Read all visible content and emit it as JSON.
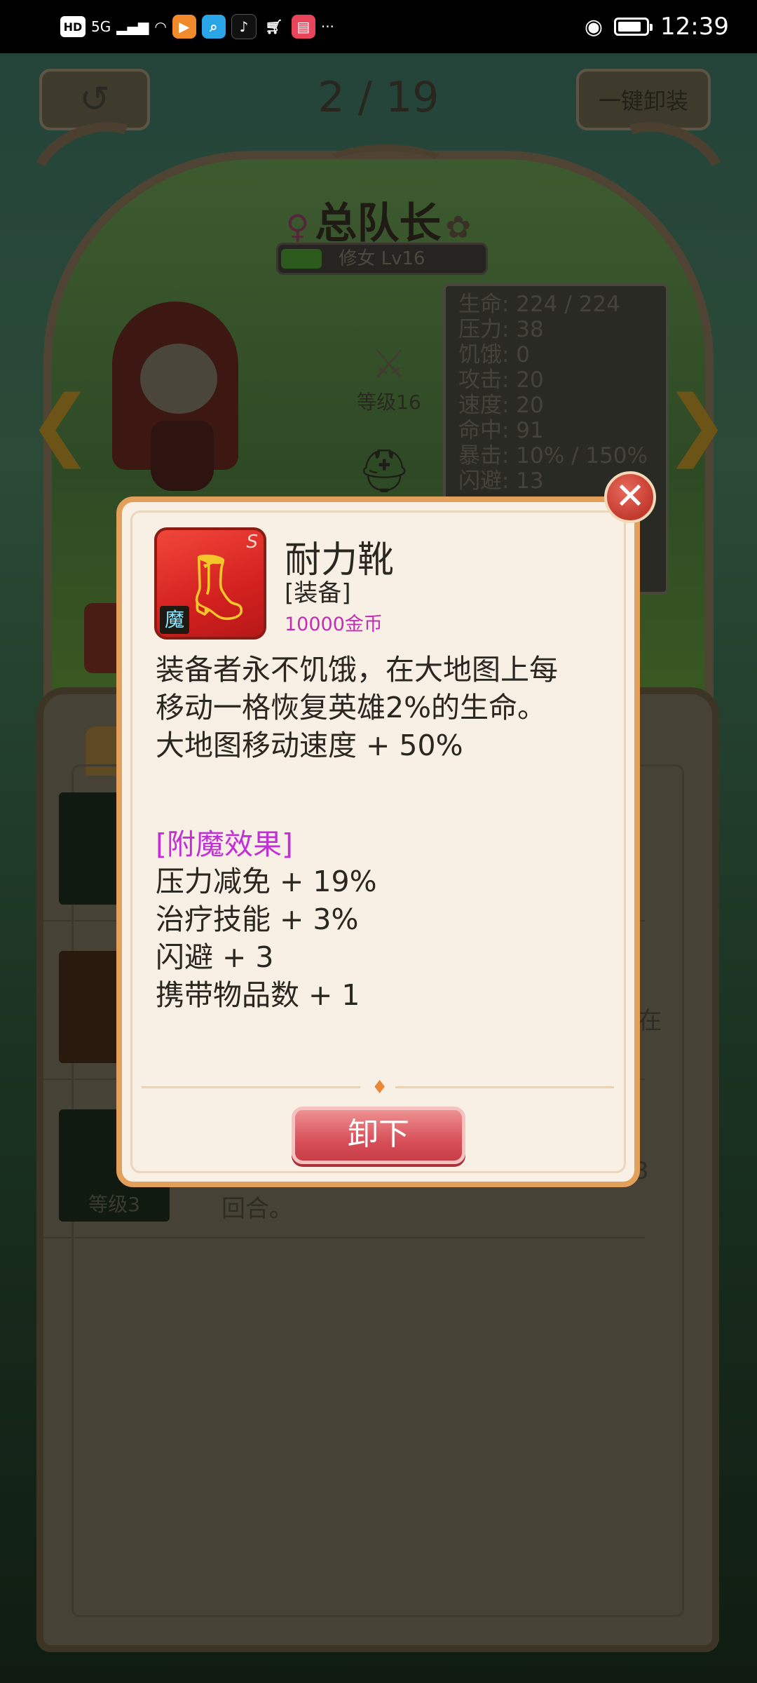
{
  "status_bar": {
    "hd": "HD",
    "network": "5G",
    "more": "···",
    "time": "12:39",
    "battery_level": 0.85,
    "app_icons": [
      "video-app",
      "search-app",
      "tiktok-app",
      "shopping-app",
      "reader-app"
    ]
  },
  "header": {
    "page_counter": "2 / 19",
    "unequip_all": "一键卸装"
  },
  "hero": {
    "name": "总队长",
    "class_level": "修女 Lv16",
    "xp_fraction": 0.2,
    "weapon_level": "等级16",
    "stats": [
      "生命: 224 / 224",
      "压力: 38",
      "饥饿: 0",
      "攻击: 20",
      "速度: 20",
      "命中: 91",
      "暴击: 10% / 150%",
      "闪避: 13"
    ]
  },
  "background_list": {
    "row2_text_fragment": "在",
    "row3_level": "等级3",
    "row3_text_fragment": "回合。",
    "row3_num_fragment": "3"
  },
  "item_modal": {
    "name": "耐力靴",
    "type": "[装备]",
    "price": "10000金币",
    "rarity": "S",
    "enchant_tag": "魔",
    "description_lines": [
      "装备者永不饥饿，在大地图上每",
      "移动一格恢复英雄2%的生命。",
      "大地图移动速度 + 50%"
    ],
    "enchant_title": "[附魔效果]",
    "enchant_effects": [
      "压力减免 + 19%",
      "治疗技能 + 3%",
      "闪避 + 3",
      "携带物品数 + 1"
    ],
    "unequip_label": "卸下"
  },
  "colors": {
    "modal_border": "#e2a05a",
    "price_color": "#c22fb4",
    "enchant_color": "#c22fd8",
    "button_red": "#d8505a"
  }
}
